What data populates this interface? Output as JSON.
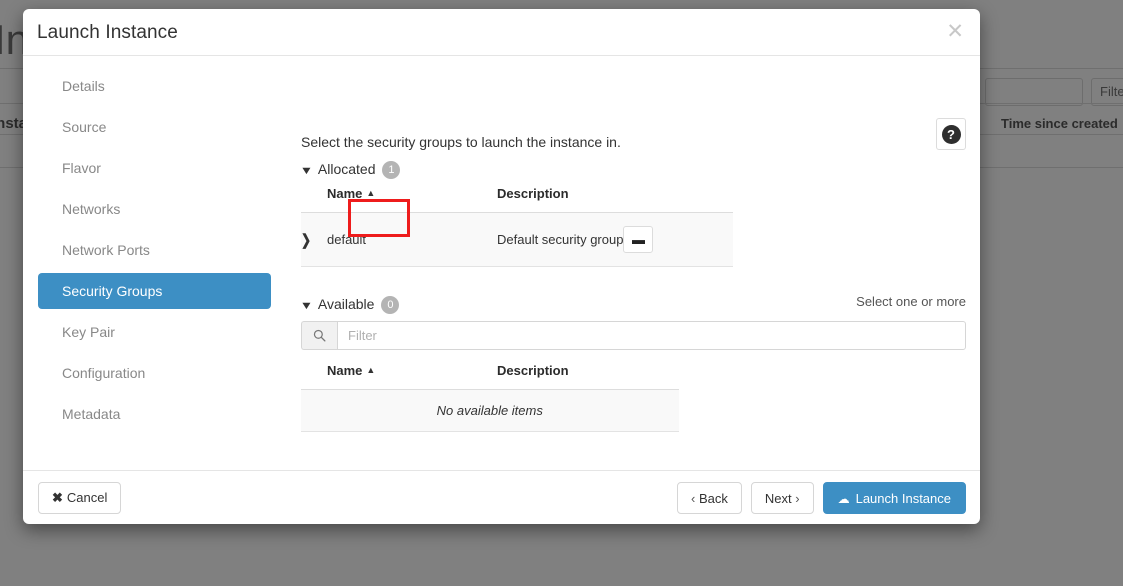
{
  "background": {
    "page_title": "Instances",
    "subtitle": "Instances",
    "search_value": "",
    "filter_button_label": "Filter",
    "column_header": "Time since created"
  },
  "modal": {
    "title": "Launch Instance",
    "close_icon": "close-icon",
    "help_icon": "help-icon",
    "help_glyph": "?"
  },
  "sidebar": {
    "items": [
      {
        "label": "Details",
        "active": false
      },
      {
        "label": "Source",
        "active": false
      },
      {
        "label": "Flavor",
        "active": false
      },
      {
        "label": "Networks",
        "active": false
      },
      {
        "label": "Network Ports",
        "active": false
      },
      {
        "label": "Security Groups",
        "active": true
      },
      {
        "label": "Key Pair",
        "active": false
      },
      {
        "label": "Configuration",
        "active": false
      },
      {
        "label": "Metadata",
        "active": false
      }
    ]
  },
  "panel": {
    "intro": "Select the security groups to launch the instance in.",
    "select_hint": "Select one or more",
    "allocated": {
      "label": "Allocated",
      "count": "1",
      "caret_icon": "chevron-down-icon",
      "columns": {
        "name": "Name",
        "description": "Description"
      },
      "sort_icon": "sort-asc-icon",
      "rows": [
        {
          "expand_icon": "chevron-right-icon",
          "name": "default",
          "description": "Default security group",
          "action_icon": "minus-icon",
          "action_label": "—"
        }
      ]
    },
    "available": {
      "label": "Available",
      "count": "0",
      "caret_icon": "chevron-down-icon",
      "columns": {
        "name": "Name",
        "description": "Description"
      },
      "sort_icon": "sort-asc-icon",
      "empty_text": "No available items",
      "filter": {
        "placeholder": "Filter",
        "value": "",
        "icon": "search-icon"
      }
    }
  },
  "footer": {
    "cancel_label": "Cancel",
    "cancel_icon": "x-icon",
    "back_label": "Back",
    "back_icon": "chevron-left-icon",
    "next_label": "Next",
    "next_icon": "chevron-right-icon",
    "launch_label": "Launch Instance",
    "launch_icon": "cloud-upload-icon"
  },
  "colors": {
    "accent_blue": "#3d8fc4",
    "backdrop_gray": "#808080",
    "badge_gray": "#b4b4b4",
    "highlight_red": "#ee1c1c"
  }
}
